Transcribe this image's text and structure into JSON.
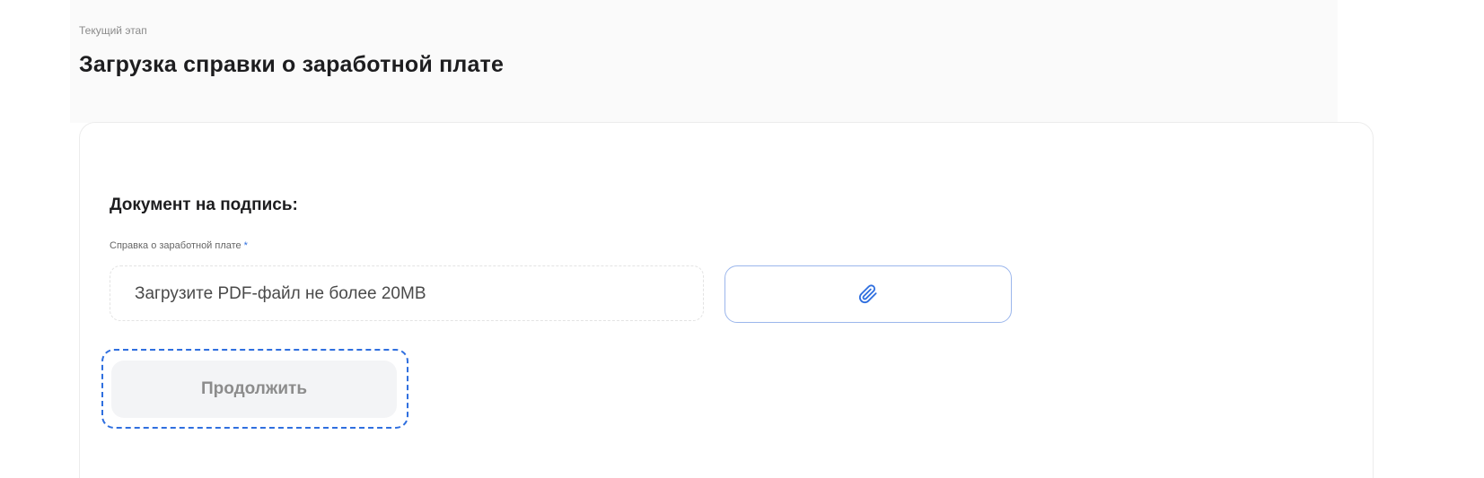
{
  "header": {
    "stage_caption": "Текущий этап",
    "title": "Загрузка справки о заработной плате"
  },
  "form": {
    "section_title": "Документ на подпись:",
    "field_label": "Справка о заработной плате",
    "required_mark": "*",
    "upload_placeholder": "Загрузите PDF-файл не более 20MB",
    "attach_icon": "paperclip-icon",
    "continue_label": "Продолжить"
  },
  "colors": {
    "accent": "#2f6fdf",
    "attach_border": "#9bb6ec",
    "disabled_button_bg": "#f3f4f6",
    "disabled_button_text": "#8c8c8c"
  }
}
